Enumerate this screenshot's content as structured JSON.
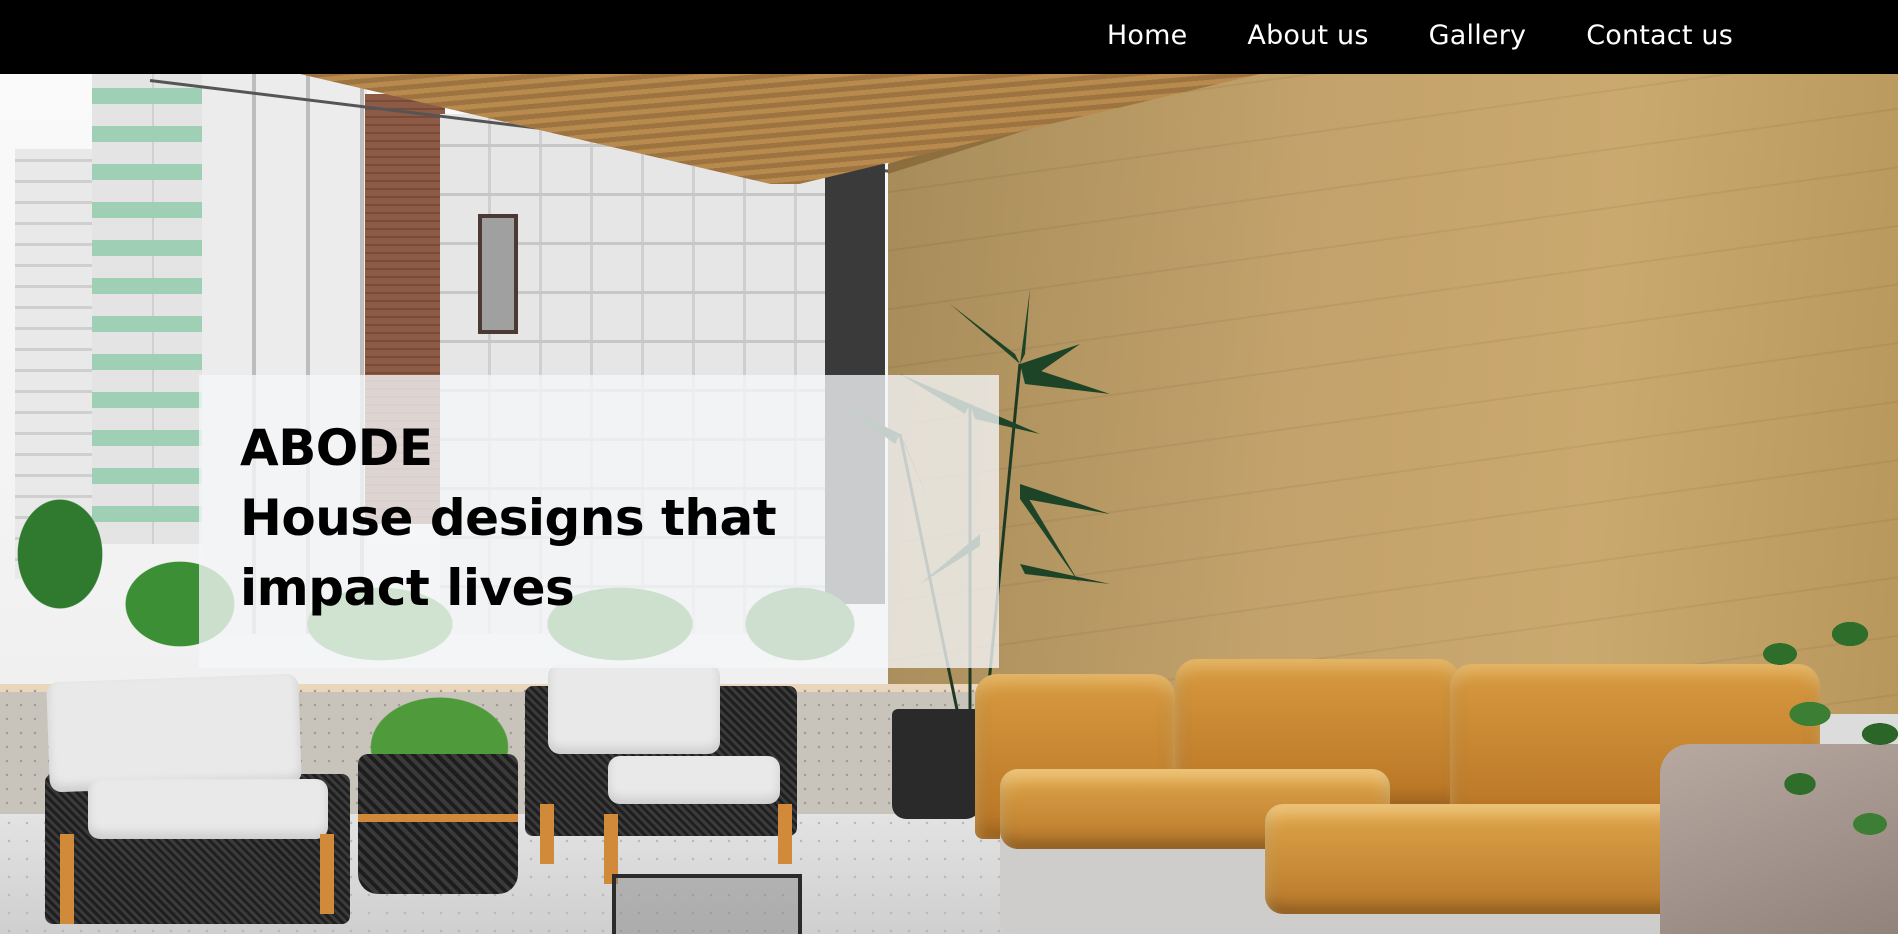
{
  "nav": {
    "links": [
      {
        "label": "Home"
      },
      {
        "label": "About us"
      },
      {
        "label": "Gallery"
      },
      {
        "label": "Contact us"
      }
    ]
  },
  "hero": {
    "brand": "ABODE",
    "tagline_line1": "House designs that",
    "tagline_line2": "impact lives",
    "image_subject": "patio-lounge-photo"
  },
  "colors": {
    "navbar_bg": "#000000",
    "nav_text": "#ffffff",
    "card_bg": "#f5f6f8",
    "headline_text": "#000000"
  }
}
